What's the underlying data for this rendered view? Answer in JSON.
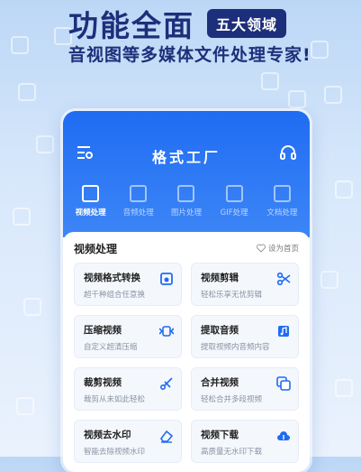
{
  "promo": {
    "headline": "功能全面",
    "badge": "五大领域",
    "subline": "音视图等多媒体文件处理专家!"
  },
  "app": {
    "title": "格式工厂",
    "tabs": [
      {
        "label": "视频处理",
        "active": true,
        "icon": "video-file-icon"
      },
      {
        "label": "音频处理",
        "active": false,
        "icon": "audio-file-icon"
      },
      {
        "label": "图片处理",
        "active": false,
        "icon": "image-file-icon"
      },
      {
        "label": "GIF处理",
        "active": false,
        "icon": "gif-file-icon"
      },
      {
        "label": "文档处理",
        "active": false,
        "icon": "document-file-icon"
      }
    ],
    "section": {
      "title": "视频处理",
      "set_home": "设为首页"
    },
    "cards": [
      {
        "title": "视频格式转换",
        "desc": "超千种组合任意换",
        "icon": "convert-icon"
      },
      {
        "title": "视频剪辑",
        "desc": "轻松乐享无忧剪辑",
        "icon": "scissors-icon"
      },
      {
        "title": "压缩视频",
        "desc": "自定义超清压缩",
        "icon": "compress-icon"
      },
      {
        "title": "提取音频",
        "desc": "提取视频内音频内容",
        "icon": "music-icon"
      },
      {
        "title": "裁剪视频",
        "desc": "裁剪从未如此轻松",
        "icon": "crop-icon"
      },
      {
        "title": "合并视频",
        "desc": "轻松合并多段视频",
        "icon": "merge-icon"
      },
      {
        "title": "视频去水印",
        "desc": "智能去除视频水印",
        "icon": "eraser-icon"
      },
      {
        "title": "视频下载",
        "desc": "高质量无水印下载",
        "icon": "cloud-download-icon"
      }
    ],
    "accent": "#1f6cf2",
    "promo_text_color": "#1d2f7a"
  }
}
